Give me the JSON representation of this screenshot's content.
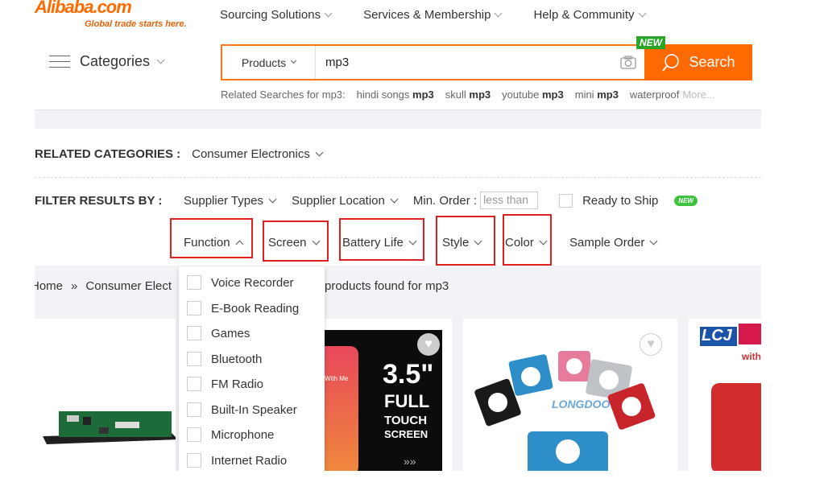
{
  "header": {
    "logo_text": "Alibaba.com",
    "logo_tagline": "Global trade starts here.",
    "nav": [
      "Sourcing Solutions",
      "Services & Membership",
      "Help & Community"
    ],
    "categories_label": "Categories"
  },
  "search": {
    "category": "Products",
    "query": "mp3",
    "button_label": "Search",
    "badge": "NEW",
    "accent": "#ff6a00"
  },
  "related_searches": {
    "prefix": "Related Searches for mp3:",
    "items": [
      {
        "pre": "hindi songs ",
        "bold": "mp3"
      },
      {
        "pre": "skull ",
        "bold": "mp3"
      },
      {
        "pre": "youtube ",
        "bold": "mp3"
      },
      {
        "pre": "mini ",
        "bold": "mp3"
      },
      {
        "pre": "waterproof",
        "bold": ""
      }
    ],
    "more": "More..."
  },
  "related_categories": {
    "label": "RELATED CATEGORIES :",
    "value": "Consumer Electronics"
  },
  "filters": {
    "label": "FILTER RESULTS BY :",
    "supplier_types": "Supplier Types",
    "supplier_location": "Supplier Location",
    "min_order_label": "Min. Order :",
    "min_order_placeholder": "less than",
    "ready_to_ship": "Ready to Ship",
    "ready_badge": "NEW",
    "row2": [
      "Function",
      "Screen",
      "Battery Life",
      "Style",
      "Color",
      "Sample Order"
    ]
  },
  "breadcrumb": {
    "home": "Home",
    "sep": "»",
    "current": "Consumer Elect",
    "found": "products found for mp3"
  },
  "function_dropdown": {
    "options": [
      "Voice Recorder",
      "E-Book Reading",
      "Games",
      "Bluetooth",
      "FM Radio",
      "Built-In Speaker",
      "Microphone",
      "Internet Radio"
    ]
  },
  "products": {
    "card2_text": {
      "size": "3.5\"",
      "full": "FULL",
      "touch": "TOUCH",
      "screen": "SCREEN",
      "app": "With Me"
    },
    "card3_brand": "LONGDOO",
    "card4_brand": "LCJ",
    "card4_sub": "with"
  }
}
